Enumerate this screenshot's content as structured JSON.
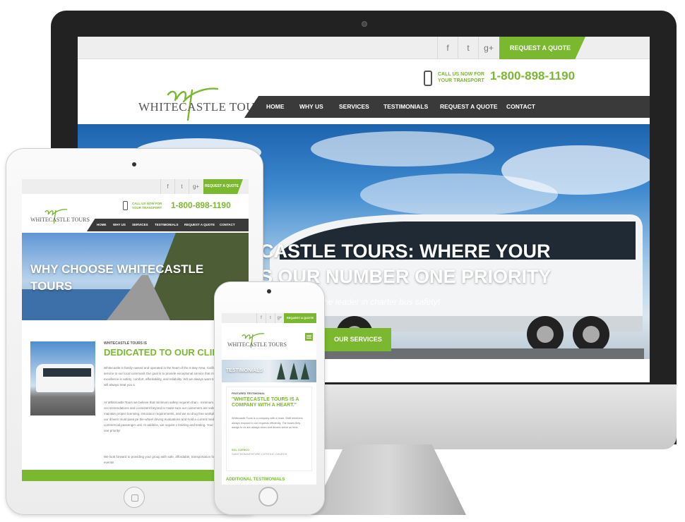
{
  "desktop": {
    "topbar": {
      "social": [
        {
          "icon": "facebook-icon",
          "glyph": "f"
        },
        {
          "icon": "twitter-icon",
          "glyph": "t"
        },
        {
          "icon": "google-plus-icon",
          "glyph": "g+"
        }
      ],
      "quote_label": "REQUEST A QUOTE"
    },
    "logo_text": "WHITECASTLE TOURS",
    "call_text": "CALL US NOW FOR YOUR TRANSPORT",
    "phone_number": "1-800-898-1190",
    "nav": [
      "HOME",
      "WHY US",
      "SERVICES",
      "TESTIMONIALS",
      "REQUEST A QUOTE",
      "CONTACT"
    ],
    "hero": {
      "title_line1": "CASTLE TOURS: WHERE YOUR",
      "title_line2": "S OUR NUMBER ONE PRIORITY",
      "subtitle": "the leader in charter bus safety!",
      "button": "OUR SERVICES"
    }
  },
  "tablet": {
    "quote_label": "REQUEST A QUOTE",
    "logo_text": "WHITECASTLE TOURS",
    "call_text": "CALL US NOW FOR YOUR TRANSPORT",
    "phone_number": "1-800-898-1190",
    "nav": [
      "HOME",
      "WHY US",
      "SERVICES",
      "TESTIMONIALS",
      "REQUEST A QUOTE",
      "CONTACT"
    ],
    "hero_title": "WHY CHOOSE WHITECASTLE TOURS",
    "kicker": "WHITECASTLE TOURS IS",
    "heading": "DEDICATED TO OUR CLIEN",
    "paragraphs": [
      "Whitecastle is family-owned and operated in the heart of the S Bay Area, California. We provide service to our local communit Our goal is to provide exceptional service that meets our high excellence in safety, comfort, affordability, and reliability. Wit we always want to know your name and will always treat you a",
      "At Whitecastle Tours we believe that minimum safety requiren than - minimum. We exceed recommendations and consistent beyond to make sure our customers are safe at all times while maintain proper licensing, insurance requirements, and we su drug free workplace! Additionally, all our drivers must pass pe the-wheel driving evaluations and hold a current medical clea driving a commercial passenger unit. In addition, we require c training and testing. Your safety is our number one priority!",
      "We look forward to providing your group with safe, affordable, transportation for any and all of your events!"
    ]
  },
  "phone": {
    "quote_label": "REQUEST A QUOTE",
    "logo_text": "WHITECASTLE TOURS",
    "hero_label": "TESTIMONIALS",
    "kicker": "FEATURED TESTIMONIAL",
    "quote_title": "\"WHITECASTLE TOURS IS A COMPANY WITH A HEART.\"",
    "body": "Whitecastle Tours is a company with a heart. Staff members always respond to our requests efficiently. The buses they assign to us are always clean and drivers arrive on time.",
    "author": "SOL CUENCO",
    "org": "SAINT BONAVENTURE CATHOLIC CHURCH",
    "additional": "ADDITIONAL TESTIMONIALS"
  },
  "colors": {
    "accent": "#7ab82f",
    "nav": "#3a3a3a",
    "topbar": "#eeeeee"
  }
}
